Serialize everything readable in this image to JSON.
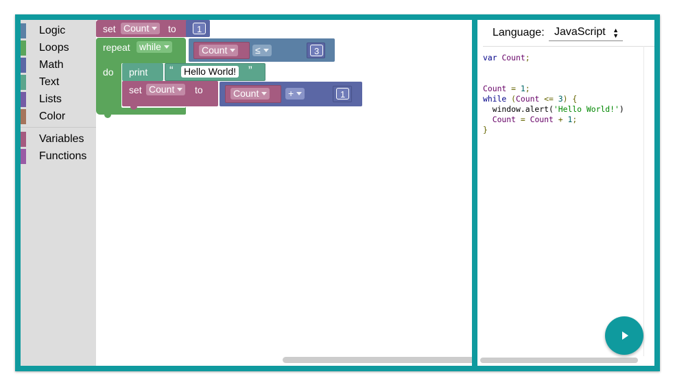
{
  "toolbox": {
    "categories": [
      {
        "label": "Logic",
        "color": "#5b80a5"
      },
      {
        "label": "Loops",
        "color": "#5ba55b"
      },
      {
        "label": "Math",
        "color": "#5b67a5"
      },
      {
        "label": "Text",
        "color": "#5ba58c"
      },
      {
        "label": "Lists",
        "color": "#745ba5"
      },
      {
        "label": "Color",
        "color": "#a5745b"
      },
      {
        "label": "Variables",
        "color": "#a55b80"
      },
      {
        "label": "Functions",
        "color": "#995ba5"
      }
    ]
  },
  "workspace": {
    "set1": {
      "set": "set",
      "var": "Count",
      "to": "to",
      "value": "1"
    },
    "repeat": {
      "keyword": "repeat",
      "mode": "while",
      "do": "do",
      "compare_var": "Count",
      "operator": "≤",
      "compare_value": "3"
    },
    "print": {
      "keyword": "print",
      "open_quote": "“",
      "text": "Hello World!",
      "close_quote": "”"
    },
    "set2": {
      "set": "set",
      "var": "Count",
      "to": "to",
      "lhs_var": "Count",
      "operator": "+",
      "value": "1"
    }
  },
  "code_panel": {
    "language_label": "Language:",
    "language": "JavaScript",
    "code": {
      "l1_kw": "var",
      "l1_var": "Count",
      "l1_end": ";",
      "l4_var": "Count",
      "l4_mid": " = ",
      "l4_num": "1",
      "l4_end": ";",
      "l5_kw": "while",
      "l5_a": " (",
      "l5_var": "Count",
      "l5_op": " <= ",
      "l5_num": "3",
      "l5_b": ") {",
      "l6_a": "  window.alert(",
      "l6_str": "'Hello World!'",
      "l6_b": ")",
      "l7_a": "  ",
      "l7_var1": "Count",
      "l7_mid": " = ",
      "l7_var2": "Count",
      "l7_plus": " + ",
      "l7_num": "1",
      "l7_end": ";",
      "l8": "}"
    }
  },
  "colors": {
    "frame": "#0f9a9e",
    "variables": "#a55b80",
    "loops": "#5ba55b",
    "math": "#5b67a5",
    "text": "#5ba58c",
    "logic": "#5b80a5"
  }
}
